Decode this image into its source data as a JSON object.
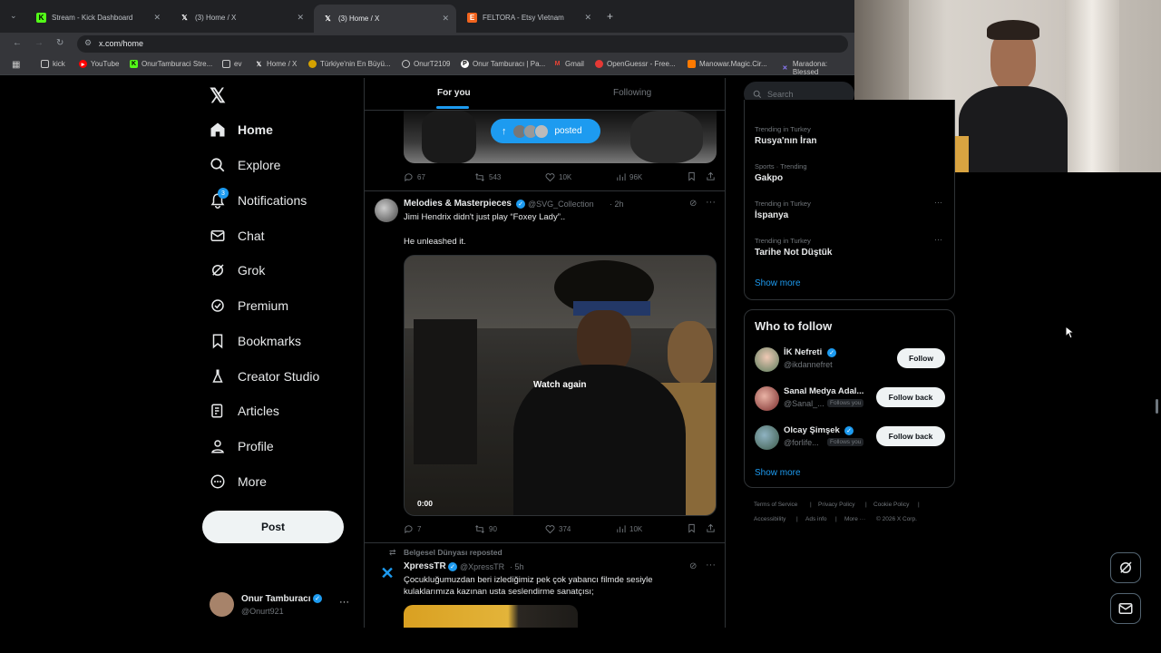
{
  "browser": {
    "tabs": [
      {
        "title": "Stream - Kick Dashboard",
        "icon": "kick-icon"
      },
      {
        "title": "(3) Home / X",
        "icon": "x-logo-icon"
      },
      {
        "title": "(3) Home / X",
        "icon": "x-logo-icon",
        "active": true
      },
      {
        "title": "FELTORA - Etsy Vietnam",
        "icon": "etsy-icon"
      }
    ],
    "url": "x.com/home",
    "bookmarks": [
      "kick",
      "YouTube",
      "OnurTamburaci Stre...",
      "ev",
      "Home / X",
      "Türkiye'nin En Büyü...",
      "OnurT2109",
      "Onur Tamburacı | Pa...",
      "Gmail",
      "OpenGuessr - Free...",
      "Manowar.Magic.Cir...",
      "Maradona: Blessed"
    ]
  },
  "nav": {
    "items": [
      "Home",
      "Explore",
      "Notifications",
      "Chat",
      "Grok",
      "Premium",
      "Bookmarks",
      "Creator Studio",
      "Articles",
      "Profile",
      "More"
    ],
    "notif_badge": "3",
    "post_label": "Post",
    "account": {
      "name": "Onur Tamburacı",
      "handle": "@Onurt921"
    }
  },
  "feed": {
    "tabs": {
      "for_you": "For you",
      "following": "Following"
    },
    "posted_pill": "posted",
    "tweet0": {
      "replies": "67",
      "reposts": "543",
      "likes": "10K",
      "views": "96K"
    },
    "tweet1": {
      "name": "Melodies & Masterpieces",
      "handle": "@SVG_Collection",
      "time": "· 2h",
      "text1": "Jimi Hendrix didn't just play “Foxey Lady”..",
      "text2": "He unleashed it.",
      "watch_again": "Watch again",
      "video_time": "0:00",
      "replies": "7",
      "reposts": "90",
      "likes": "374",
      "views": "10K"
    },
    "tweet2": {
      "repost_by": "Belgesel Dünyası reposted",
      "name": "XpressTR",
      "handle": "@XpressTR",
      "time": "· 5h",
      "text": "Çocukluğumuzdan beri izlediğimiz pek çok yabancı filmde sesiyle kulaklarımıza kazınan usta seslendirme sanatçısı;"
    }
  },
  "sidebar": {
    "search_placeholder": "Search",
    "trends": [
      {
        "cat": "Trending in Turkey",
        "name": "Rusya'nın İran"
      },
      {
        "cat": "Sports · Trending",
        "name": "Gakpo"
      },
      {
        "cat": "Trending in Turkey",
        "name": "İspanya"
      },
      {
        "cat": "Trending in Turkey",
        "name": "Tarihe Not Düştük"
      }
    ],
    "show_more": "Show more",
    "who_to_follow": "Who to follow",
    "follow": [
      {
        "name": "İK Nefreti",
        "handle": "@ikdannefret",
        "button": "Follow",
        "follows_you": ""
      },
      {
        "name": "Sanal Medya Adal...",
        "handle": "@Sanal_...",
        "button": "Follow back",
        "follows_you": "Follows you"
      },
      {
        "name": "Olcay Şimşek",
        "handle": "@forlife...",
        "button": "Follow back",
        "follows_you": "Follows you"
      }
    ],
    "show_more2": "Show more",
    "footer": {
      "tos": "Terms of Service",
      "privacy": "Privacy Policy",
      "cookie": "Cookie Policy",
      "access": "Accessibility",
      "ads": "Ads info",
      "more": "More ···",
      "copyright": "© 2026 X Corp."
    }
  },
  "colors": {
    "accent": "#1d9bf0",
    "bg": "#000000",
    "border": "#2f3336",
    "muted": "#71767b"
  }
}
